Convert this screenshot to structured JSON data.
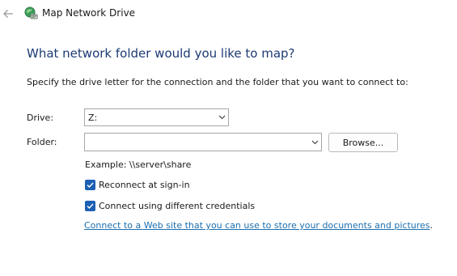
{
  "window": {
    "title": "Map Network Drive",
    "back_icon": "arrow-left-icon",
    "app_icon": "network-drive-icon"
  },
  "heading": "What network folder would you like to map?",
  "instruction": "Specify the drive letter for the connection and the folder that you want to connect to:",
  "drive": {
    "label": "Drive:",
    "value": "Z:"
  },
  "folder": {
    "label": "Folder:",
    "value": "",
    "browse_label": "Browse..."
  },
  "example": "Example: \\\\server\\share",
  "options": {
    "reconnect": {
      "label": "Reconnect at sign-in",
      "checked": true
    },
    "credentials": {
      "label": "Connect using different credentials",
      "checked": true
    }
  },
  "link": {
    "text": "Connect to a Web site that you can use to store your documents and pictures",
    "suffix": "."
  },
  "colors": {
    "heading": "#1c3a73",
    "accent": "#1d5fb4",
    "link": "#1d6fae"
  }
}
